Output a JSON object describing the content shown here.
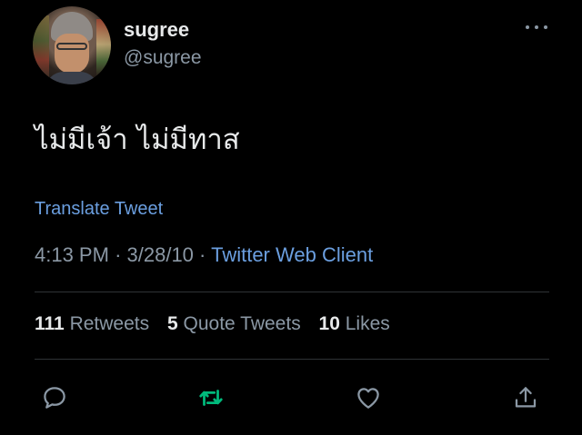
{
  "user": {
    "display_name": "sugree",
    "handle": "@sugree",
    "avatar_icon": "profile-photo"
  },
  "tweet": {
    "text": "ไม่มีเจ้า ไม่มีทาส",
    "translate_label": "Translate Tweet",
    "time": "4:13 PM",
    "separator": "·",
    "date": "3/28/10",
    "client": "Twitter Web Client"
  },
  "stats": {
    "retweets_count": "111",
    "retweets_label": "Retweets",
    "quotes_count": "5",
    "quotes_label": "Quote Tweets",
    "likes_count": "10",
    "likes_label": "Likes"
  },
  "actions": [
    {
      "name": "reply",
      "icon": "reply-icon"
    },
    {
      "name": "retweet",
      "icon": "retweet-icon"
    },
    {
      "name": "like",
      "icon": "heart-icon"
    },
    {
      "name": "share",
      "icon": "share-icon"
    }
  ],
  "colors": {
    "background": "#000000",
    "text": "#e7e9ea",
    "secondary": "#8b98a5",
    "link": "#6b9fe0",
    "retweet_active": "#00ba7c"
  }
}
